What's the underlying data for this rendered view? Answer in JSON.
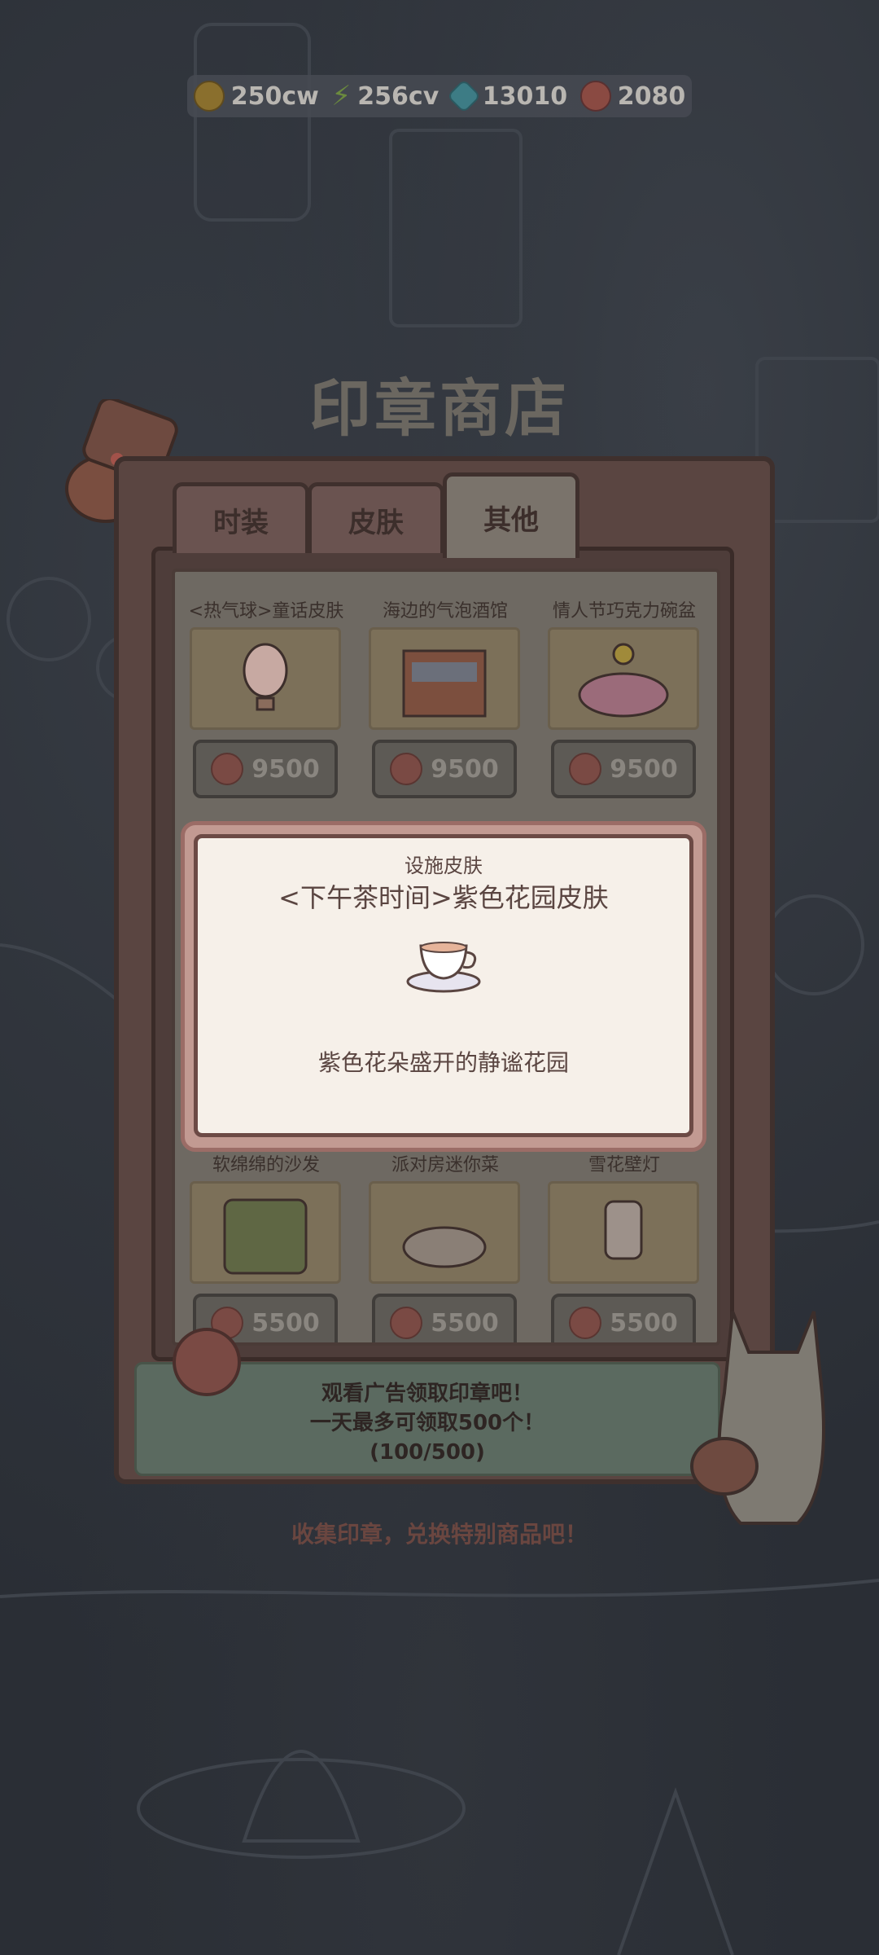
{
  "currency": [
    {
      "icon": "gold-coin-icon",
      "value": "250cw"
    },
    {
      "icon": "energy-bolt-icon",
      "value": "256cv"
    },
    {
      "icon": "gem-icon",
      "value": "13010"
    },
    {
      "icon": "paw-seal-icon",
      "value": "2080"
    }
  ],
  "shop_title": "印章商店",
  "tabs": [
    {
      "label": "时装"
    },
    {
      "label": "皮肤"
    },
    {
      "label": "其他",
      "active": true
    }
  ],
  "items_row1": [
    {
      "name": "<热气球>童话皮肤",
      "price": "9500"
    },
    {
      "name": "海边的气泡酒馆",
      "price": "9500"
    },
    {
      "name": "情人节巧克力碗盆",
      "price": "9500"
    }
  ],
  "items_row2": [
    {
      "name": "软绵绵的沙发",
      "price": "5500"
    },
    {
      "name": "派对房迷你菜",
      "price": "5500"
    },
    {
      "name": "雪花壁灯",
      "price": "5500"
    }
  ],
  "modal": {
    "category": "设施皮肤",
    "title": "<下午茶时间>紫色花园皮肤",
    "icon": "teacup-icon",
    "description": "紫色花朵盛开的静谧花园"
  },
  "ad_banner": {
    "line1": "观看广告领取印章吧！",
    "line2": "一天最多可领取500个！",
    "progress": "(100/500)"
  },
  "hint": "收集印章，兑换特别商品吧！"
}
